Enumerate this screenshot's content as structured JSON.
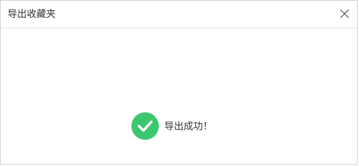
{
  "dialog": {
    "title": "导出收藏夹",
    "close_icon": "close-icon"
  },
  "message": {
    "text": "导出成功！",
    "icon": "check-circle-icon",
    "icon_color": "#3cc76f"
  },
  "colors": {
    "title_text": "#333333",
    "border": "#cfcfcf",
    "close_icon": "#666666"
  }
}
